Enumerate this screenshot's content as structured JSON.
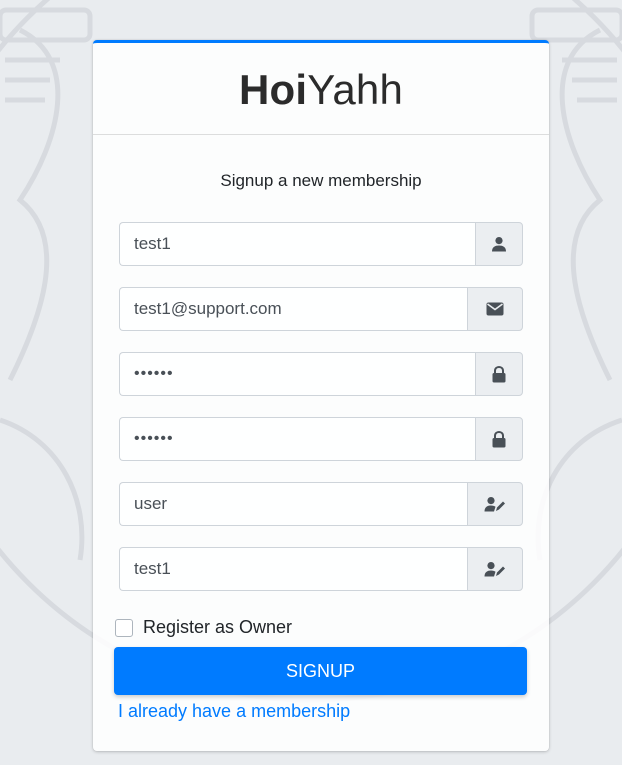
{
  "brand": {
    "bold": "Hoi",
    "light": "Yahh"
  },
  "subtitle": "Signup a new membership",
  "fields": [
    {
      "name": "username",
      "type": "text",
      "value": "test1",
      "icon": "user-icon"
    },
    {
      "name": "email",
      "type": "text",
      "value": "test1@support.com",
      "icon": "envelope-icon"
    },
    {
      "name": "password",
      "type": "password",
      "value": "123456",
      "icon": "lock-icon"
    },
    {
      "name": "password-confirm",
      "type": "password",
      "value": "123456",
      "icon": "lock-icon"
    },
    {
      "name": "role",
      "type": "text",
      "value": "user",
      "icon": "user-edit-icon"
    },
    {
      "name": "display-name",
      "type": "text",
      "value": "test1",
      "icon": "user-edit-icon"
    }
  ],
  "owner_checkbox": {
    "label": "Register as Owner",
    "checked": false
  },
  "signup_button": "SIGNUP",
  "login_link": "I already have a membership",
  "colors": {
    "primary": "#007bff",
    "background": "#e9ecef"
  }
}
